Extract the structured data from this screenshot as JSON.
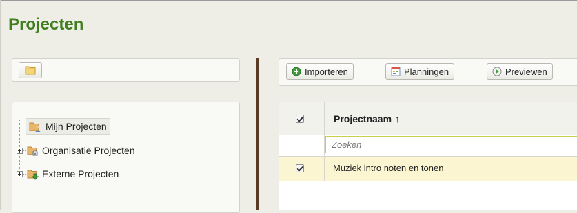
{
  "page": {
    "title": "Projecten"
  },
  "tree": {
    "items": [
      {
        "label": "Mijn Projecten",
        "selected": true,
        "icon": "folder-user-icon"
      },
      {
        "label": "Organisatie Projecten",
        "selected": false,
        "icon": "folder-organization-icon"
      },
      {
        "label": "Externe Projecten",
        "selected": false,
        "icon": "folder-external-icon"
      }
    ]
  },
  "toolbar": {
    "import_label": "Importeren",
    "schedules_label": "Planningen",
    "preview_label": "Previewen"
  },
  "grid": {
    "header": {
      "column_name": "Projectnaam",
      "sort_indicator": "↑",
      "select_all_checked": true
    },
    "search": {
      "placeholder": "Zoeken"
    },
    "rows": [
      {
        "name": "Muziek intro noten en tonen",
        "checked": true
      }
    ]
  },
  "colors": {
    "title": "#3f7f1f",
    "splitter": "#5a3b27",
    "selected_row": "#fbf5d2",
    "search_border": "#c9cf4a"
  }
}
